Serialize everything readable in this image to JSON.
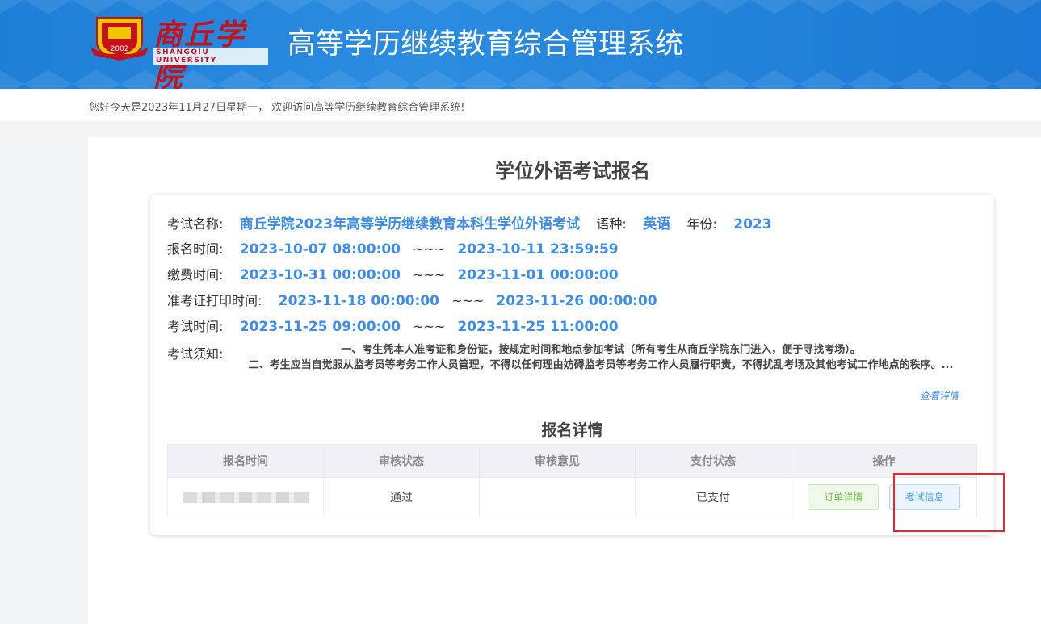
{
  "header": {
    "logo_cn": "商丘学院",
    "logo_en": "SHANGQIU UNIVERSITY",
    "logo_year": "2002",
    "system_title": "高等学历继续教育综合管理系统"
  },
  "welcome": "您好今天是2023年11月27日星期一， 欢迎访问高等学历继续教育综合管理系统!",
  "page_title": "学位外语考试报名",
  "exam": {
    "name_label": "考试名称:",
    "name_value": "商丘学院2023年高等学历继续教育本科生学位外语考试",
    "lang_label": "语种:",
    "lang_value": "英语",
    "year_label": "年份:",
    "year_value": "2023",
    "reg_label": "报名时间:",
    "reg_start": "2023-10-07 08:00:00",
    "reg_end": "2023-10-11 23:59:59",
    "pay_label": "缴费时间:",
    "pay_start": "2023-10-31 00:00:00",
    "pay_end": "2023-11-01 00:00:00",
    "print_label": "准考证打印时间:",
    "print_start": "2023-11-18 00:00:00",
    "print_end": "2023-11-26 00:00:00",
    "exam_label": "考试时间:",
    "exam_start": "2023-11-25 09:00:00",
    "exam_end": "2023-11-25 11:00:00",
    "separator": "~~~",
    "notice_label": "考试须知:",
    "notice_line1": "一、考生凭本人准考证和身份证，按规定时间和地点参加考试（所有考生从商丘学院东门进入，便于寻找考场）。",
    "notice_line2": "二、考生应当自觉服从监考员等考务工作人员管理，不得以任何理由妨碍监考员等考务工作人员履行职责，不得扰乱考场及其他考试工作地点的秩序。...",
    "more_link": "查看详情"
  },
  "detail": {
    "title": "报名详情",
    "columns": [
      "报名时间",
      "审核状态",
      "审核意见",
      "支付状态",
      "操作"
    ],
    "row": {
      "review_status": "通过",
      "review_opinion": "",
      "pay_status": "已支付",
      "order_btn": "订单详情",
      "exam_btn": "考试信息"
    }
  },
  "colors": {
    "header_blue": "#2b8ce0",
    "value_blue": "#3c8ce8",
    "highlight_red": "#e8262d"
  }
}
